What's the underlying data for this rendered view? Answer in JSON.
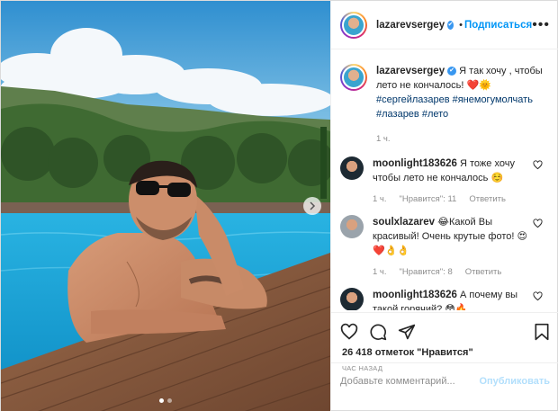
{
  "post": {
    "author": "lazarevsergey",
    "follow_label": "Подписаться",
    "caption_text": "Я так хочу , чтобы лето не кончалось! ❤️🌞",
    "hashtags": [
      "#сергейлазарев",
      "#янемогумолчать",
      "#лазарев",
      "#лето"
    ],
    "caption_time": "1 ч.",
    "likes": "26 418 отметок \"Нравится\"",
    "posted_ago": "ЧАС НАЗАД",
    "carousel": {
      "slides": 2,
      "active": 1
    }
  },
  "comments": [
    {
      "user": "moonlight183626",
      "text": "Я тоже хочу чтобы лето не кончалось ☺️",
      "time": "1 ч.",
      "likes_label": "\"Нравится\": 11",
      "reply_label": "Ответить"
    },
    {
      "user": "soulxlazarev",
      "text": "😂Какой Вы красивый! Очень крутые фото! 😍❤️👌👌",
      "time": "1 ч.",
      "likes_label": "\"Нравится\": 8",
      "reply_label": "Ответить"
    },
    {
      "user": "moonlight183626",
      "text": "А почему вы такой горячий? 😳🔥"
    }
  ],
  "composer": {
    "placeholder": "Добавьте комментарий...",
    "publish_label": "Опубликовать"
  },
  "icons": [
    "verified-icon",
    "more-options-icon",
    "like-icon",
    "comment-icon",
    "share-icon",
    "save-icon",
    "next-slide-icon",
    "comment-heart-icon"
  ],
  "colors": {
    "accent": "#0095f6",
    "verified": "#3897f0",
    "publish_disabled": "#b2dffc",
    "pool": "#1aa7d8"
  }
}
